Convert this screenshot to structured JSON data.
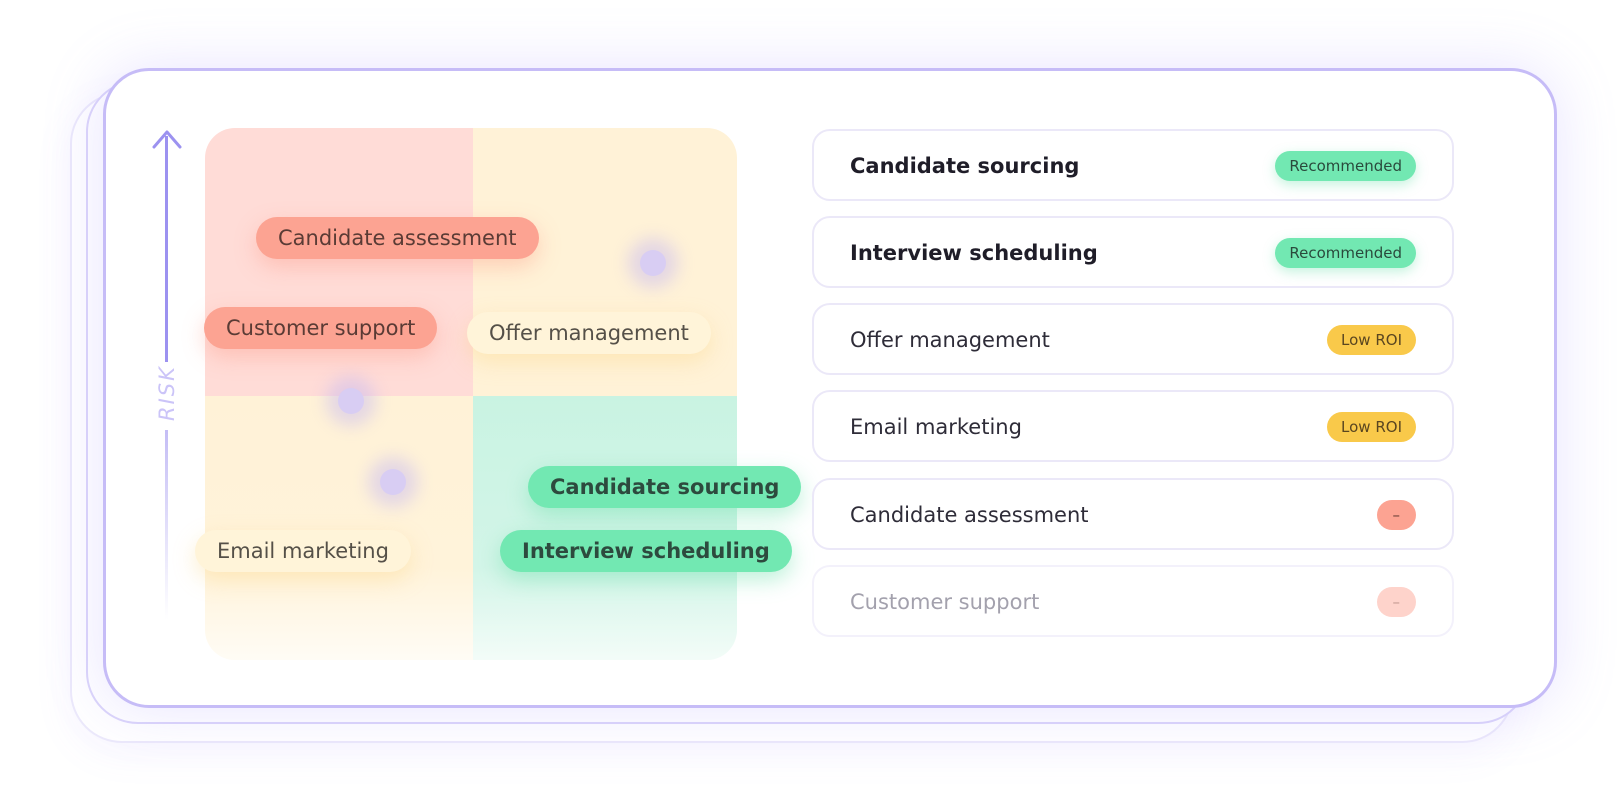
{
  "axis": {
    "label": "RISK"
  },
  "matrix": {
    "pills": [
      {
        "label": "Candidate assessment",
        "quadrant": "top-left",
        "color": "#fca392"
      },
      {
        "label": "Customer support",
        "quadrant": "top-left",
        "color": "#fca392"
      },
      {
        "label": "Offer management",
        "quadrant": "top-right",
        "color": "#fff4d9"
      },
      {
        "label": "Email marketing",
        "quadrant": "bottom-left",
        "color": "#fff4d9"
      },
      {
        "label": "Candidate sourcing",
        "quadrant": "bottom-right",
        "color": "#72e8b2"
      },
      {
        "label": "Interview scheduling",
        "quadrant": "bottom-right",
        "color": "#72e8b2"
      }
    ],
    "quadrant_colors": {
      "top-left": "#ffdcd7",
      "top-right": "#fff2d7",
      "bottom-left": "#fff2d7",
      "bottom-right": "#c9f3e2"
    }
  },
  "list": [
    {
      "label": "Candidate sourcing",
      "badge": "Recommended",
      "status": "recommended"
    },
    {
      "label": "Interview scheduling",
      "badge": "Recommended",
      "status": "recommended"
    },
    {
      "label": "Offer management",
      "badge": "Low ROI",
      "status": "low-roi"
    },
    {
      "label": "Email marketing",
      "badge": "Low ROI",
      "status": "low-roi"
    },
    {
      "label": "Candidate assessment",
      "badge": "–",
      "status": "none"
    },
    {
      "label": "Customer support",
      "badge": "–",
      "status": "none-faded"
    }
  ],
  "colors": {
    "accent": "#9c92f0",
    "recommended": "#72e8b2",
    "low_roi": "#f9c94a",
    "negative": "#fca392"
  }
}
